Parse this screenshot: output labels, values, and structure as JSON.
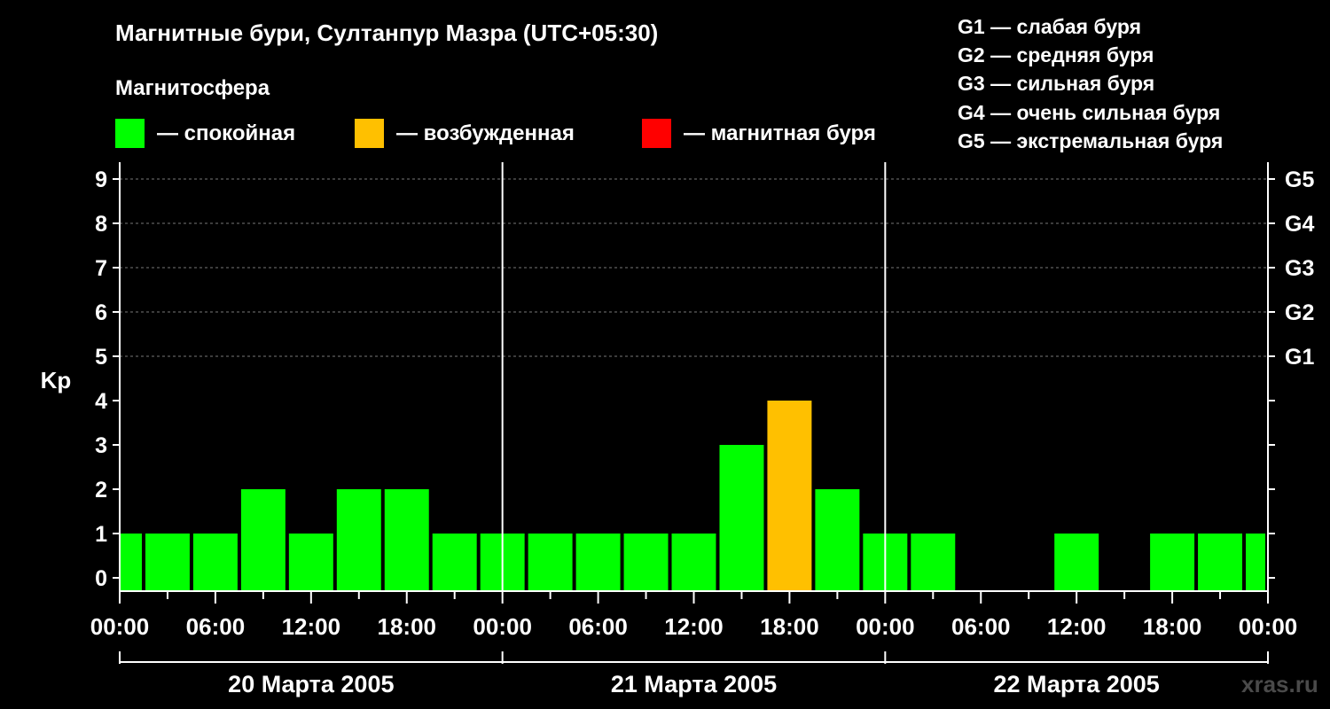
{
  "title": "Магнитные бури, Султанпур Мазра (UTC+05:30)",
  "subtitle": "Магнитосфера",
  "legend": [
    {
      "label": "— спокойная",
      "color": "#00ff00"
    },
    {
      "label": "— возбужденная",
      "color": "#ffc000"
    },
    {
      "label": "— магнитная буря",
      "color": "#ff0000"
    }
  ],
  "g_levels": [
    "G1 — слабая буря",
    "G2 — средняя буря",
    "G3 — сильная буря",
    "G4 — очень сильная буря",
    "G5 — экстремальная буря"
  ],
  "watermark": "xras.ru",
  "chart_data": {
    "type": "bar",
    "ylabel": "Kp",
    "ylim": [
      0,
      9
    ],
    "yticks": [
      "0",
      "1",
      "2",
      "3",
      "4",
      "5",
      "6",
      "7",
      "8",
      "9"
    ],
    "right_ticks": [
      {
        "value": 5,
        "label": "G1"
      },
      {
        "value": 6,
        "label": "G2"
      },
      {
        "value": 7,
        "label": "G3"
      },
      {
        "value": 8,
        "label": "G4"
      },
      {
        "value": 9,
        "label": "G5"
      }
    ],
    "xtick_labels": [
      "00:00",
      "06:00",
      "12:00",
      "18:00",
      "00:00",
      "06:00",
      "12:00",
      "18:00",
      "00:00",
      "06:00",
      "12:00",
      "18:00",
      "00:00"
    ],
    "day_labels": [
      "20 Марта 2005",
      "21 Марта 2005",
      "22 Марта 2005"
    ],
    "grid": "dashed horizontal at 5,6,7,8,9",
    "bar_colors": {
      "quiet": "#00ff00",
      "active": "#ffc000",
      "storm": "#ff0000"
    },
    "categories": [
      "20 Марта 2005 00:00",
      "20 Марта 2005 03:00",
      "20 Марта 2005 06:00",
      "20 Марта 2005 09:00",
      "20 Марта 2005 12:00",
      "20 Марта 2005 15:00",
      "20 Марта 2005 18:00",
      "20 Марта 2005 21:00",
      "21 Марта 2005 00:00",
      "21 Марта 2005 03:00",
      "21 Марта 2005 06:00",
      "21 Марта 2005 09:00",
      "21 Марта 2005 12:00",
      "21 Марта 2005 15:00",
      "21 Марта 2005 18:00",
      "21 Марта 2005 21:00",
      "22 Марта 2005 00:00",
      "22 Марта 2005 03:00",
      "22 Марта 2005 06:00",
      "22 Марта 2005 09:00",
      "22 Марта 2005 12:00",
      "22 Марта 2005 15:00",
      "22 Марта 2005 18:00",
      "22 Марта 2005 21:00",
      "23 Марта 2005 00:00"
    ],
    "values": [
      1,
      1,
      1,
      2,
      1,
      2,
      2,
      1,
      1,
      1,
      1,
      1,
      1,
      3,
      4,
      2,
      1,
      1,
      0,
      0,
      1,
      0,
      1,
      1,
      1
    ],
    "levels": [
      "quiet",
      "quiet",
      "quiet",
      "quiet",
      "quiet",
      "quiet",
      "quiet",
      "quiet",
      "quiet",
      "quiet",
      "quiet",
      "quiet",
      "quiet",
      "quiet",
      "active",
      "quiet",
      "quiet",
      "quiet",
      "quiet",
      "quiet",
      "quiet",
      "quiet",
      "quiet",
      "quiet",
      "quiet"
    ]
  }
}
